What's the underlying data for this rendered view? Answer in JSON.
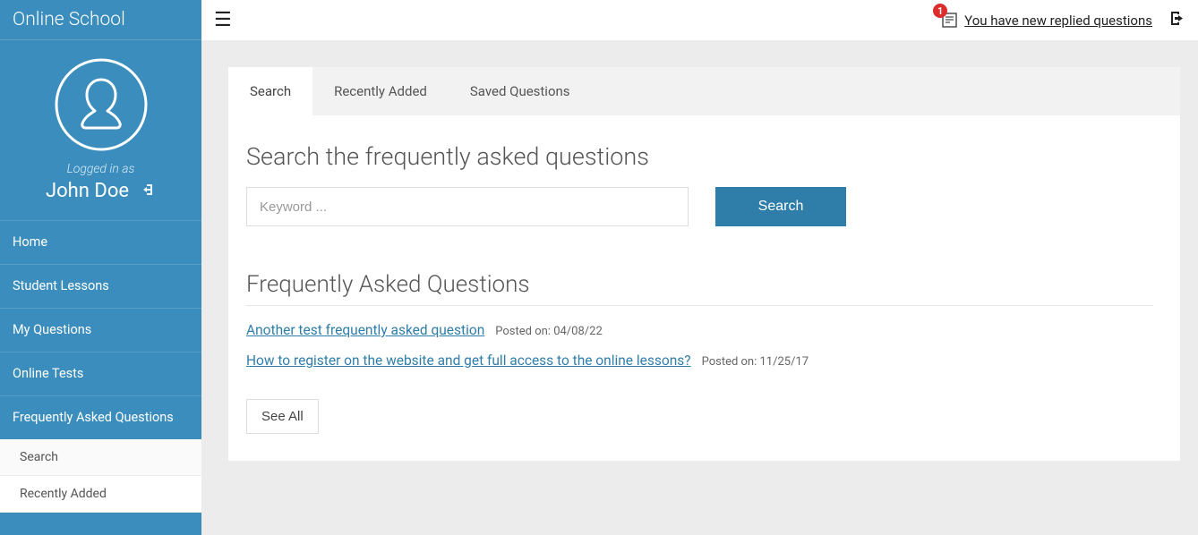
{
  "brand": "Online School",
  "user": {
    "logged_in_as": "Logged in as",
    "name": "John Doe"
  },
  "nav": {
    "items": [
      {
        "label": "Home"
      },
      {
        "label": "Student Lessons"
      },
      {
        "label": "My Questions"
      },
      {
        "label": "Online Tests"
      },
      {
        "label": "Frequently Asked Questions"
      }
    ],
    "sub": [
      {
        "label": "Search"
      },
      {
        "label": "Recently Added"
      }
    ]
  },
  "topbar": {
    "notif_count": "1",
    "notif_text": "You have new replied questions"
  },
  "tabs": [
    {
      "label": "Search",
      "active": true
    },
    {
      "label": "Recently Added"
    },
    {
      "label": "Saved Questions"
    }
  ],
  "search": {
    "heading": "Search the frequently asked questions",
    "placeholder": "Keyword ...",
    "button": "Search"
  },
  "faq": {
    "heading": "Frequently Asked Questions",
    "posted_prefix": "Posted on: ",
    "items": [
      {
        "title": "Another test frequently asked question",
        "date": "04/08/22"
      },
      {
        "title": "How to register on the website and get full access to the online lessons?",
        "date": "11/25/17"
      }
    ],
    "see_all": "See All"
  }
}
